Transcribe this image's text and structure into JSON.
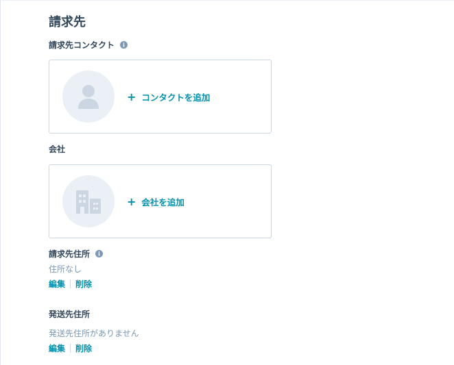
{
  "section": {
    "title": "請求先"
  },
  "billing_contact": {
    "label": "請求先コンタクト",
    "add_label": "コンタクトを追加",
    "info_icon": "info-icon",
    "avatar_icon": "person-icon"
  },
  "company": {
    "label": "会社",
    "add_label": "会社を追加",
    "avatar_icon": "building-icon"
  },
  "billing_address": {
    "label": "請求先住所",
    "value": "住所なし",
    "edit_label": "編集",
    "delete_label": "削除",
    "info_icon": "info-icon"
  },
  "shipping_address": {
    "label": "発送先住所",
    "value": "発送先住所がありません",
    "edit_label": "編集",
    "delete_label": "削除"
  },
  "colors": {
    "link": "#0091ae",
    "text": "#33475b",
    "muted": "#7c98b6",
    "border": "#cbd6e2",
    "avatar_bg": "#eaf0f6",
    "icon_fill": "#cbd6e2"
  }
}
